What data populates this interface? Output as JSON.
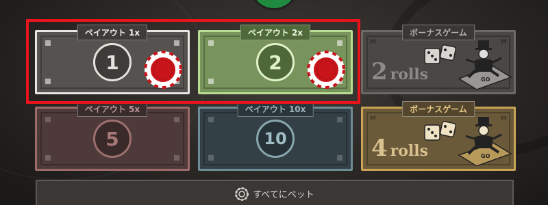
{
  "bets": {
    "payout_1x": {
      "label": "ペイアウト 1x",
      "number": "1"
    },
    "payout_2x": {
      "label": "ペイアウト 2x",
      "number": "2"
    },
    "payout_5x": {
      "label": "ペイアウト 5x",
      "number": "5"
    },
    "payout_10x": {
      "label": "ペイアウト 10x",
      "number": "10"
    }
  },
  "bonus": [
    {
      "label": "ボーナスゲーム",
      "rolls": "2",
      "rolls_word": "rolls"
    },
    {
      "label": "ボーナスゲーム",
      "rolls": "4",
      "rolls_word": "rolls"
    }
  ],
  "bet_all": {
    "label": "すべてにベット"
  },
  "colors": {
    "selection_outline": "#e8141b",
    "chip": "#c8141b",
    "chip_edge": "#ffffff"
  }
}
